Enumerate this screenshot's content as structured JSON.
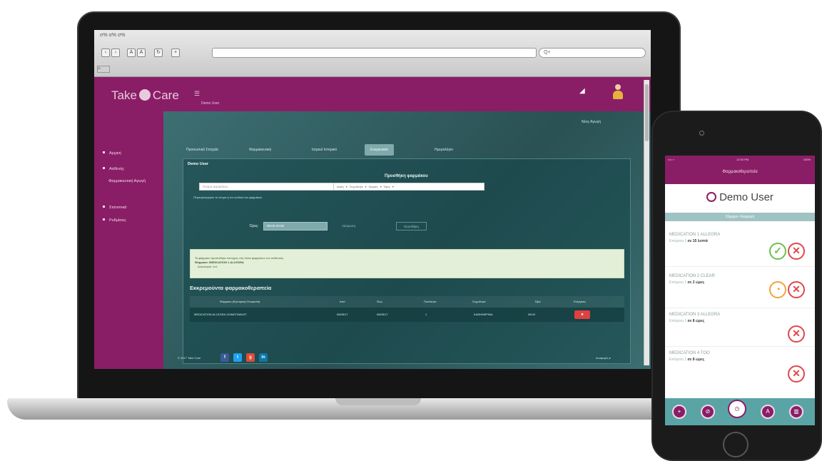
{
  "browser": {
    "window_title": "σ% σ% σ%",
    "search_placeholder": "Q+",
    "tab_label": "⌂"
  },
  "app": {
    "logo_text_left": "Take",
    "logo_text_right": "Care",
    "menu_glyph": "☰",
    "subtitle": "Demo User",
    "chart_icon": "◢",
    "sidebar": {
      "items": [
        {
          "label": "Αρχική"
        },
        {
          "label": "Ασθενής"
        },
        {
          "label": "Φαρμακευτική Αγωγή"
        },
        {
          "label": "Στατιστικά"
        },
        {
          "label": "Ρυθμίσεις"
        }
      ]
    },
    "top_right_links": "Νέος   Αγωγή",
    "tabs": [
      {
        "label": "Προσωπικά Στοιχεία"
      },
      {
        "label": "Φαρμακευτική"
      },
      {
        "label": "Ιατρικό Ιστορικό"
      },
      {
        "label": "Ενεργειακό"
      },
      {
        "label": "Ημερολόγιο"
      }
    ],
    "panel": {
      "title": "Demo User",
      "heading": "Προσθήκη φαρμάκου",
      "input_placeholder": "Όνομα φαρμάκου...",
      "input_help": "Πληκτρολογήστε το όνομα ή τον κωδικό του φαρμάκου",
      "filters": "Δόση ▾  Συχνότητα ▾  Ημέρες ▾  Ώρες ▾",
      "stat_label": "Ώρες:",
      "stat_value": "08:00-20:00",
      "ghost_button_1": "Ακύρωση",
      "ghost_button_2": "Προσθήκη",
      "alert_line_1": "Το φάρμακο προστέθηκε επιτυχώς στη λίστα φαρμάκων του ασθενούς.",
      "alert_line_2": "Φάρμακο: MEDICATION 1 ALLEGRA",
      "alert_line_3": "Δοσολογία: 1x1",
      "section_title": "Εκκρεμούντα φαρμακοθεραπεία",
      "table": {
        "headers": [
          "Φάρμακο (Εμπορική Ονομασία)",
          "Από",
          "Έως",
          "Ποσότητα",
          "Συχνότητα",
          "Ώρα",
          "Ενέργειες"
        ],
        "row": [
          "MEDICATION ALLEGRA 120MG/TABLET",
          "06/05/17",
          "06/05/17",
          "1",
          "ΚΑΘΗΜΕΡΙΝΑ",
          "08:00",
          "✖"
        ]
      }
    },
    "footer": {
      "text": "© 2017 Take Care",
      "social": [
        "f",
        "t",
        "g",
        "in"
      ],
      "right_text": "Αναφορές ▸"
    }
  },
  "phone": {
    "status_left": "•••• ≈",
    "status_time": "12:00 PM",
    "status_right": "100%",
    "title": "Φαρμακοθεραπεία",
    "user_name": "Demo User",
    "banner": "Σήμερα • Εκκρεμή",
    "items": [
      {
        "name": "MEDICATION 1 ALLEGRA",
        "sub_prefix": "Επόμενη 1",
        "sub_time": "σε 15 λεπτά",
        "status": "taken"
      },
      {
        "name": "MEDICATION 2 CLEAR",
        "sub_prefix": "Επόμενη 1",
        "sub_time": "σε 2 ώρες",
        "status": "pending"
      },
      {
        "name": "MEDICATION 3 ALLEGRA",
        "sub_prefix": "Επόμενη 1",
        "sub_time": "σε 8 ώρες",
        "status": "none"
      },
      {
        "name": "MEDICATION 4 TOO",
        "sub_prefix": "Επόμενη 1",
        "sub_time": "σε 8 ώρες",
        "status": "none"
      }
    ],
    "bottom_tabs": [
      {
        "icon": "plus-icon",
        "glyph": "+"
      },
      {
        "icon": "pill-icon",
        "glyph": "⊘"
      },
      {
        "icon": "clock-icon",
        "glyph": "◷"
      },
      {
        "icon": "user-icon",
        "glyph": "A"
      },
      {
        "icon": "chart-icon",
        "glyph": "▥"
      }
    ],
    "glyphs": {
      "ok": "✓",
      "x": "✕",
      "wait": "◔"
    }
  },
  "colors": {
    "brand_plum": "#8a1e66",
    "content_teal": "#2a5154",
    "phone_teal": "#5aa4a6",
    "ok_green": "#6dbf4a",
    "cancel_red": "#e0464a",
    "wait_orange": "#f0a33a"
  }
}
